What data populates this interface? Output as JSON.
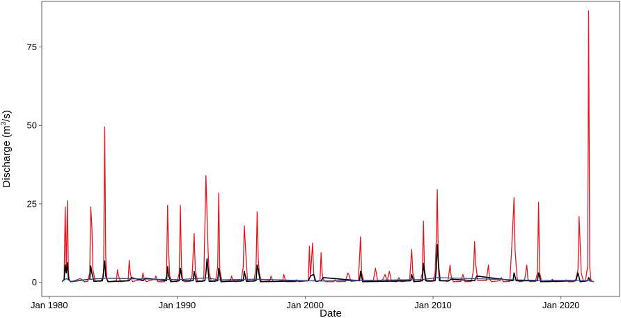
{
  "chart_data": {
    "type": "line",
    "xlabel": "Date",
    "ylabel": "Discharge (m³/s)",
    "ylabel_parts": {
      "before": "Discharge (m",
      "sup": "3",
      "after": "/s)"
    },
    "xlim": [
      "1979-06-01",
      "2024-08-01"
    ],
    "ylim": [
      -4.5,
      89.5
    ],
    "x_ticks": [
      {
        "date": "1980-01-01",
        "label": "Jan 1980"
      },
      {
        "date": "1990-01-01",
        "label": "Jan 1990"
      },
      {
        "date": "2000-01-01",
        "label": "Jan 2000"
      },
      {
        "date": "2010-01-01",
        "label": "Jan 2010"
      },
      {
        "date": "2020-01-01",
        "label": "Jan 2020"
      }
    ],
    "y_ticks": [
      0,
      25,
      50,
      75
    ],
    "grid": false,
    "series": [
      {
        "color": "#e8141c",
        "x": [
          "1981-01-01",
          "1981-03-01",
          "1981-04-01",
          "1981-05-01",
          "1981-06-01",
          "1981-07-01",
          "1981-08-01",
          "1981-10-01",
          "1982-06-01",
          "1982-10-01",
          "1983-01-01",
          "1983-03-01",
          "1983-04-01",
          "1983-05-01",
          "1983-06-01",
          "1983-08-01",
          "1984-01-01",
          "1984-04-01",
          "1984-05-01",
          "1984-06-01",
          "1984-07-01",
          "1984-09-01",
          "1985-04-01",
          "1985-05-01",
          "1985-06-01",
          "1985-08-01",
          "1986-03-01",
          "1986-04-01",
          "1986-05-01",
          "1986-07-01",
          "1987-04-01",
          "1987-05-01",
          "1987-06-01",
          "1987-08-01",
          "1988-04-01",
          "1988-05-01",
          "1988-07-01",
          "1989-01-01",
          "1989-03-01",
          "1989-04-01",
          "1989-05-01",
          "1989-06-01",
          "1989-08-01",
          "1990-01-01",
          "1990-03-01",
          "1990-04-01",
          "1990-05-01",
          "1990-06-01",
          "1990-08-01",
          "1991-01-01",
          "1991-03-01",
          "1991-05-01",
          "1991-06-01",
          "1991-08-01",
          "1992-01-01",
          "1992-02-01",
          "1992-04-01",
          "1992-06-01",
          "1992-07-01",
          "1992-09-01",
          "1993-01-01",
          "1993-03-01",
          "1993-04-01",
          "1993-05-01",
          "1993-07-01",
          "1994-03-01",
          "1994-04-01",
          "1994-05-01",
          "1994-07-01",
          "1995-01-01",
          "1995-03-01",
          "1995-04-01",
          "1995-05-01",
          "1995-07-01",
          "1996-01-01",
          "1996-03-01",
          "1996-04-01",
          "1996-05-01",
          "1996-06-01",
          "1996-08-01",
          "1997-04-01",
          "1997-05-01",
          "1997-07-01",
          "1998-04-01",
          "1998-05-01",
          "1998-07-01",
          "1999-04-01",
          "1999-05-01",
          "1999-07-01",
          "2000-04-01",
          "2000-05-01",
          "2000-06-01",
          "2000-08-01",
          "2000-09-01",
          "2000-10-01",
          "2000-12-01",
          "2001-03-01",
          "2001-04-01",
          "2001-05-01",
          "2001-06-01",
          "2001-08-01",
          "2002-04-01",
          "2002-05-01",
          "2002-07-01",
          "2003-03-01",
          "2003-05-01",
          "2003-06-01",
          "2003-08-01",
          "2004-03-01",
          "2004-05-01",
          "2004-06-01",
          "2004-08-01",
          "2005-05-01",
          "2005-07-01",
          "2005-09-01",
          "2005-11-01",
          "2006-02-01",
          "2006-04-01",
          "2006-06-01",
          "2006-08-01",
          "2006-10-01",
          "2007-03-01",
          "2007-05-01",
          "2007-07-01",
          "2008-03-01",
          "2008-05-01",
          "2008-06-01",
          "2008-08-01",
          "2009-01-01",
          "2009-03-01",
          "2009-04-01",
          "2009-05-01",
          "2009-07-01",
          "2010-01-01",
          "2010-03-01",
          "2010-04-01",
          "2010-05-01",
          "2010-06-01",
          "2010-08-01",
          "2011-03-01",
          "2011-05-01",
          "2011-06-01",
          "2011-08-01",
          "2012-03-01",
          "2012-05-01",
          "2012-07-01",
          "2013-01-01",
          "2013-03-01",
          "2013-04-01",
          "2013-05-01",
          "2013-07-01",
          "2014-03-01",
          "2014-05-01",
          "2014-06-01",
          "2014-08-01",
          "2015-04-01",
          "2015-05-01",
          "2015-07-01",
          "2016-01-01",
          "2016-03-01",
          "2016-05-01",
          "2016-06-01",
          "2016-08-01",
          "2016-10-01",
          "2017-01-01",
          "2017-03-01",
          "2017-05-01",
          "2017-06-01",
          "2017-08-01",
          "2018-01-01",
          "2018-03-01",
          "2018-04-01",
          "2018-05-01",
          "2018-07-01",
          "2019-03-01",
          "2019-05-01",
          "2019-07-01",
          "2020-04-01",
          "2020-06-01",
          "2020-08-01",
          "2021-01-01",
          "2021-03-01",
          "2021-05-01",
          "2021-06-01",
          "2021-08-01",
          "2021-10-01",
          "2021-12-01",
          "2022-01-01",
          "2022-02-01",
          "2022-03-01",
          "2022-04-01",
          "2022-05-01",
          "2022-06-01",
          "2022-08-01"
        ],
        "y": [
          0.2,
          1,
          24,
          3,
          26,
          3,
          0.5,
          0.2,
          1.2,
          0.2,
          0.3,
          3,
          24,
          18,
          4,
          0.5,
          0.3,
          2,
          49.5,
          8,
          1,
          0.2,
          0.5,
          4,
          2,
          0.2,
          0.5,
          7,
          3,
          0.2,
          1,
          3,
          1,
          0.2,
          1,
          2,
          0.2,
          0.2,
          2,
          24.5,
          10,
          2,
          0.3,
          0.2,
          3,
          24.5,
          5,
          1,
          0.2,
          0.3,
          2,
          15.5,
          4,
          0.5,
          0.3,
          2,
          34,
          10,
          3,
          0.3,
          0.3,
          5,
          28.5,
          4,
          0.3,
          0.5,
          2,
          1,
          0.2,
          0.3,
          5,
          18,
          12,
          0.5,
          0.3,
          5,
          22.5,
          8,
          3,
          0.3,
          0.5,
          2,
          0.2,
          0.5,
          2.5,
          0.2,
          0.2,
          0.8,
          0.2,
          0.5,
          11.5,
          2,
          12.5,
          3,
          0.5,
          0.2,
          0.5,
          9.5,
          3,
          1,
          0.2,
          0.2,
          0.8,
          0.2,
          0.3,
          3,
          2.5,
          0.3,
          0.5,
          14.5,
          3,
          0.3,
          0.5,
          4.5,
          0.5,
          0.3,
          1,
          2.5,
          0.3,
          3.5,
          0.3,
          0.2,
          1.5,
          0.2,
          0.5,
          10.5,
          3,
          0.3,
          0.3,
          3,
          19.5,
          4,
          0.3,
          0.3,
          3,
          13,
          29.5,
          6,
          0.5,
          0.3,
          5.5,
          2,
          0.2,
          0.3,
          2.5,
          0.2,
          0.3,
          4,
          13,
          6,
          0.5,
          0.5,
          5.5,
          1,
          0.2,
          0.5,
          1.5,
          0.2,
          0.3,
          12,
          27,
          10,
          1,
          0.2,
          0.3,
          1,
          5.5,
          1,
          0.2,
          0.3,
          3,
          25.5,
          3,
          0.2,
          0.2,
          1,
          0.2,
          0.3,
          0.8,
          0.2,
          0.2,
          1,
          4,
          21,
          3,
          0.5,
          0.5,
          3,
          5,
          86.5,
          5,
          1,
          0.3,
          0.2
        ]
      },
      {
        "color": "#000000",
        "x": [
          "1981-01-01",
          "1981-03-01",
          "1981-04-01",
          "1981-05-01",
          "1981-06-01",
          "1981-07-01",
          "1981-09-01",
          "1983-03-01",
          "1983-04-01",
          "1983-05-01",
          "1983-07-01",
          "1984-03-01",
          "1984-05-01",
          "1984-06-01",
          "1984-08-01",
          "1986-04-01",
          "1986-06-01",
          "1987-05-01",
          "1987-07-01",
          "1989-03-01",
          "1989-04-01",
          "1989-05-01",
          "1989-07-01",
          "1990-03-01",
          "1990-04-01",
          "1990-06-01",
          "1991-04-01",
          "1991-05-01",
          "1991-07-01",
          "1992-03-01",
          "1992-04-01",
          "1992-05-01",
          "1992-07-01",
          "1993-03-01",
          "1993-04-01",
          "1993-06-01",
          "1995-03-01",
          "1995-04-01",
          "1995-06-01",
          "1996-03-01",
          "1996-04-01",
          "1996-05-01",
          "1996-07-01",
          "2000-04-01",
          "2000-06-01",
          "2000-09-01",
          "2000-11-01",
          "2001-04-01",
          "2001-06-01",
          "2004-04-01",
          "2004-05-01",
          "2004-07-01",
          "2008-04-01",
          "2008-05-01",
          "2008-07-01",
          "2009-03-01",
          "2009-04-01",
          "2009-06-01",
          "2010-03-01",
          "2010-04-01",
          "2010-05-01",
          "2010-07-01",
          "2011-04-01",
          "2011-06-01",
          "2013-04-01",
          "2013-06-01",
          "2016-04-01",
          "2016-05-01",
          "2016-07-01",
          "2018-03-01",
          "2018-04-01",
          "2018-06-01",
          "2021-03-01",
          "2021-05-01",
          "2021-07-01",
          "2022-02-01",
          "2022-03-01",
          "2022-05-01"
        ],
        "y": [
          0.2,
          0.8,
          5.5,
          3,
          6.2,
          1,
          0.2,
          1,
          5.2,
          3,
          0.3,
          0.5,
          6.8,
          2,
          0.2,
          0.5,
          1.5,
          0.5,
          1.3,
          0.5,
          5,
          2,
          0.2,
          0.5,
          4.5,
          0.5,
          0.5,
          3.5,
          0.2,
          0.5,
          3,
          7.5,
          0.3,
          0.5,
          4.5,
          0.2,
          0.5,
          3.5,
          0.3,
          0.5,
          5.5,
          4,
          0.2,
          0.5,
          2,
          2.5,
          0.3,
          0.5,
          1.5,
          0.5,
          3.5,
          0.2,
          0.5,
          2.5,
          0.2,
          0.5,
          6,
          0.5,
          0.5,
          4,
          12,
          0.5,
          0.5,
          1,
          0.5,
          2,
          0.5,
          3,
          0.5,
          0.5,
          3,
          0.2,
          0.5,
          3,
          0.2,
          0.5,
          1.5,
          0.2
        ]
      },
      {
        "color": "#1f4fa8",
        "x": [
          "1981-01-01",
          "1981-05-01",
          "1981-09-01",
          "1983-05-01",
          "1984-05-01",
          "1989-04-01",
          "1990-04-01",
          "1992-05-01",
          "1993-04-01",
          "1996-04-01",
          "2001-01-01",
          "2004-05-01",
          "2009-04-01",
          "2010-05-01",
          "2016-05-01",
          "2018-04-01",
          "2021-05-01",
          "2022-03-01",
          "2022-08-01"
        ],
        "y": [
          0.2,
          1.2,
          0.3,
          1,
          1.3,
          0.9,
          0.9,
          1.4,
          0.8,
          1,
          0.4,
          0.6,
          0.9,
          1.5,
          0.8,
          0.6,
          0.6,
          0.5,
          0.2
        ]
      }
    ]
  }
}
